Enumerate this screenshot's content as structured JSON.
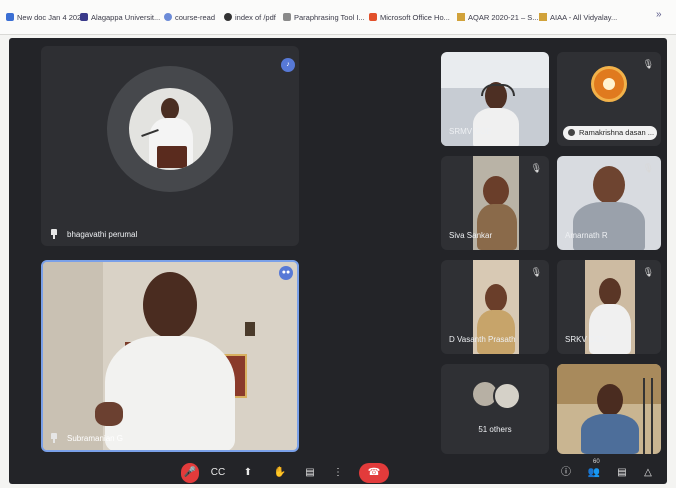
{
  "bookmarks": {
    "items": [
      {
        "label": "New doc Jan 4 202..",
        "icon": "doc-icon",
        "color": "#3b6fd4"
      },
      {
        "label": "Alagappa Universit...",
        "icon": "university-icon",
        "color": "#3a3a8a"
      },
      {
        "label": "course-read",
        "icon": "course-icon",
        "color": "#6c8bd8"
      },
      {
        "label": "index of /pdf",
        "icon": "globe-icon",
        "color": "#333333"
      },
      {
        "label": "Paraphrasing Tool I...",
        "icon": "pen-icon",
        "color": "#8a8a8a"
      },
      {
        "label": "Microsoft Office Ho...",
        "icon": "office-icon",
        "color": "#e2502a"
      },
      {
        "label": "AQAR 2020-21 – S...",
        "icon": "drive-icon",
        "color": "#d1a23a"
      },
      {
        "label": "AIAA - All Vidyalay...",
        "icon": "drive-icon",
        "color": "#d1a23a"
      }
    ],
    "overflow": "»"
  },
  "participants": {
    "main_top": {
      "name": "bhagavathi perumal"
    },
    "main_bottom": {
      "name": "Subramanian G"
    },
    "grid": [
      {
        "name": "SRMV COE"
      },
      {
        "name": "Ramakrishna dasan ..."
      },
      {
        "name": "Siva Sankar"
      },
      {
        "name": "Amarnath R"
      },
      {
        "name": "D Vasanth Prasath"
      },
      {
        "name": "SRKV COE"
      },
      {
        "name": "51 others"
      }
    ]
  },
  "controls": {
    "mic": "🎤",
    "captions": "CC",
    "present": "⬆",
    "hand": "✋",
    "more": "⋮",
    "end": "☎",
    "info": "ⓘ",
    "people_count": "60",
    "people": "👥",
    "chat": "▤",
    "activities": "△"
  },
  "colors": {
    "meeting_bg": "#232428",
    "tile_bg": "#2f3034",
    "end_call": "#e23b3b",
    "speaker": "#5779d6"
  }
}
